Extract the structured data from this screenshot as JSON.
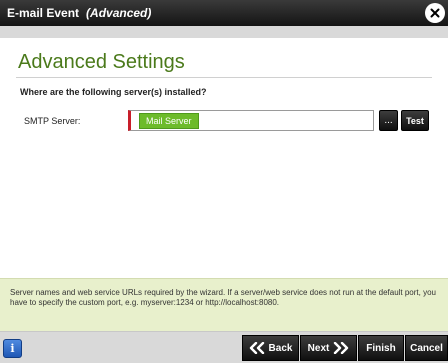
{
  "window": {
    "title": "E-mail Event",
    "subtitle": "(Advanced)",
    "close_icon": "close-icon"
  },
  "content": {
    "heading": "Advanced Settings",
    "question": "Where are the following server(s) installed?",
    "smtp": {
      "label": "SMTP Server:",
      "value": "Mail Server",
      "browse_label": "...",
      "test_label": "Test"
    }
  },
  "info": {
    "text": "Server names and web service URLs required by the wizard. If a server/web service does not run at the default port, you have to specify the custom port, e.g. myserver:1234 or http://localhost:8080."
  },
  "footer": {
    "info_label": "i",
    "back_label": "Back",
    "next_label": "Next",
    "finish_label": "Finish",
    "cancel_label": "Cancel"
  },
  "colors": {
    "heading": "#4b7a1b",
    "token": "#6dbb2b",
    "required_marker": "#c81e2a",
    "info_panel": "#e8f0cc",
    "button": "#1a1a1a"
  }
}
